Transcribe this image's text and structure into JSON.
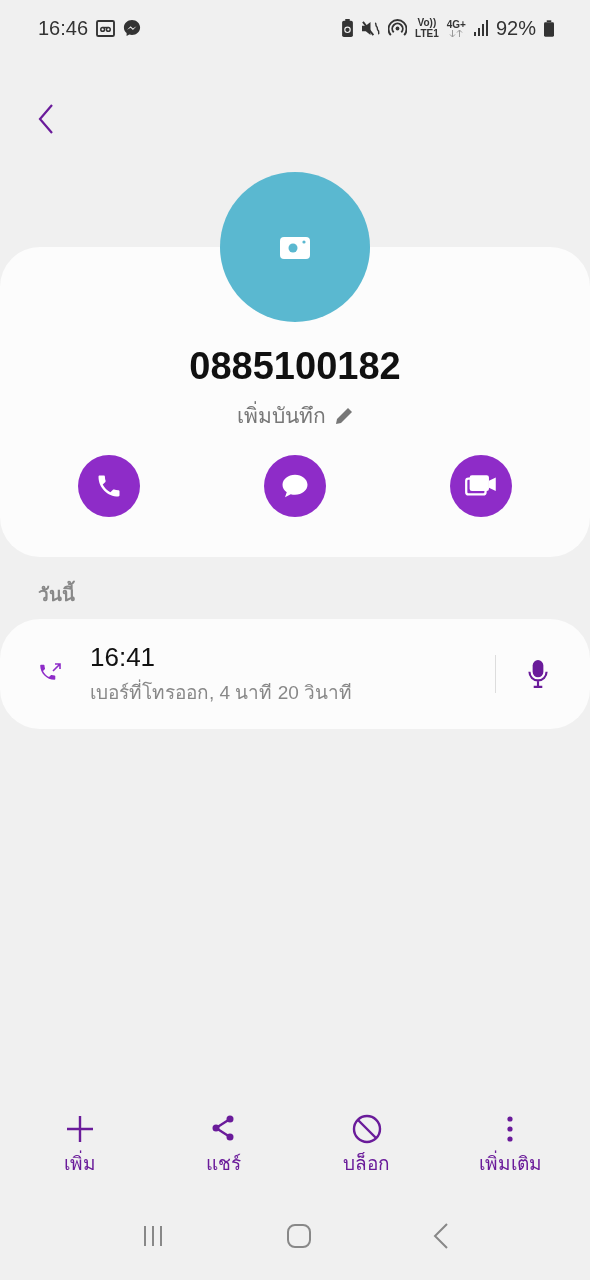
{
  "status_bar": {
    "time": "16:46",
    "volte": [
      "Vo))",
      "LTE1"
    ],
    "network": "4G+",
    "battery": "92%"
  },
  "contact": {
    "number": "0885100182",
    "note_action": "เพิ่มบันทึก"
  },
  "actions": [
    {
      "kind": "call"
    },
    {
      "kind": "message"
    },
    {
      "kind": "video"
    }
  ],
  "history": {
    "heading": "วันนี้",
    "entries": [
      {
        "kind": "outgoing",
        "time": "16:41",
        "detail": "เบอร์ที่โทรออก, 4 นาที 20 วินาที",
        "recorded": true
      }
    ]
  },
  "bottom_bar": [
    {
      "kind": "add",
      "label": "เพิ่ม"
    },
    {
      "kind": "share",
      "label": "แชร์"
    },
    {
      "kind": "block",
      "label": "บล็อก"
    },
    {
      "kind": "more",
      "label": "เพิ่มเติม"
    }
  ]
}
